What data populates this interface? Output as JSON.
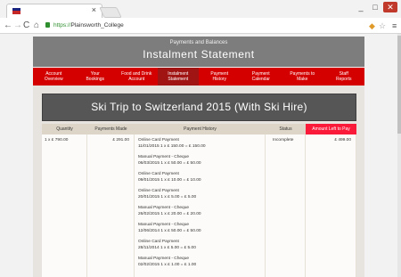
{
  "browser": {
    "tab_close": "×",
    "url_scheme": "https://",
    "url_host": "Plainsworth_College",
    "window": {
      "minimize": "_",
      "maximize": "□",
      "close": "✕"
    },
    "icons": {
      "back": "←",
      "forward": "→",
      "reload": "C",
      "home": "⌂",
      "star": "☆",
      "menu": "≡",
      "extension": "◆"
    }
  },
  "header": {
    "subtitle": "Payments and Balances",
    "title": "Instalment Statement"
  },
  "nav": [
    {
      "label": "Account\nOverview"
    },
    {
      "label": "Your\nBookings"
    },
    {
      "label": "Food and Drink\nAccount"
    },
    {
      "label": "Instalment\nStatement",
      "active": true
    },
    {
      "label": "Payment\nHistory"
    },
    {
      "label": "Payment\nCalendar"
    },
    {
      "label": "Payments to\nMake"
    },
    {
      "label": "Staff\nReports"
    }
  ],
  "trip": {
    "title": "Ski Trip to Switzerland 2015 (With Ski Hire)"
  },
  "table": {
    "headers": [
      "Quantity",
      "Payments Made",
      "Payment History",
      "Status",
      "Amount Left to Pay"
    ],
    "row": {
      "quantity": "1 x £ 790.00",
      "payments_made": "£ 291.00",
      "status": "Incomplete",
      "amount_left": "£ 499.00",
      "history": [
        {
          "type": "Online Card Payment",
          "detail": "11/01/2015 1 x   £ 150.00 =  £ 150.00"
        },
        {
          "type": "Manual Payment - Cheque",
          "detail": "06/03/2015 1 x   £ 50.00 =  £ 50.00"
        },
        {
          "type": "Online Card Payment",
          "detail": "09/01/2015 1 x   £ 10.00 =  £ 10.00"
        },
        {
          "type": "Online Card Payment",
          "detail": "20/01/2015 1 x   £ 5.00 =  £ 5.00"
        },
        {
          "type": "Manual Payment - Cheque",
          "detail": "26/02/2015 1 x   £ 20.00 =  £ 20.00"
        },
        {
          "type": "Manual Payment - Cheque",
          "detail": "12/06/2014 1 x   £ 50.00 =  £ 50.00"
        },
        {
          "type": "Online Card Payment",
          "detail": "28/11/2014 1 x   £ 5.00 =  £ 5.00"
        },
        {
          "type": "Manual Payment - Cheque",
          "detail": "02/02/2015 1 x   £ 1.00 =  £ 1.00"
        }
      ]
    }
  },
  "colors": {
    "nav_red": "#d40000",
    "nav_active": "#a11414",
    "banner_grey": "#7d7d7d",
    "amount_header": "#fa1b3b"
  }
}
